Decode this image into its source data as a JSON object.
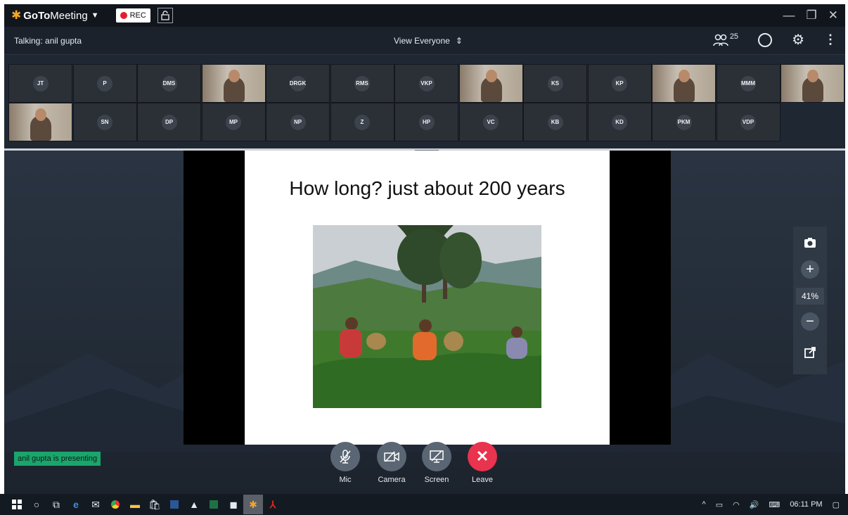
{
  "app": {
    "brand_bold": "GoTo",
    "brand_rest": "Meeting",
    "rec_label": "REC"
  },
  "infobar": {
    "talking": "Talking: anil gupta",
    "view": "View Everyone",
    "attendee_count": "25"
  },
  "participants": [
    {
      "initials": "JT",
      "video": false
    },
    {
      "initials": "P",
      "video": false
    },
    {
      "initials": "DMS",
      "video": false
    },
    {
      "initials": "",
      "video": true
    },
    {
      "initials": "DRGK",
      "video": false
    },
    {
      "initials": "RMS",
      "video": false
    },
    {
      "initials": "VKP",
      "video": false
    },
    {
      "initials": "",
      "video": true
    },
    {
      "initials": "KS",
      "video": false
    },
    {
      "initials": "KP",
      "video": false
    },
    {
      "initials": "",
      "video": true
    },
    {
      "initials": "MMM",
      "video": false
    },
    {
      "initials": "",
      "video": true
    },
    {
      "initials": "",
      "video": true
    },
    {
      "initials": "SN",
      "video": false
    },
    {
      "initials": "DP",
      "video": false
    },
    {
      "initials": "MP",
      "video": false
    },
    {
      "initials": "NP",
      "video": false
    },
    {
      "initials": "Z",
      "video": false
    },
    {
      "initials": "HP",
      "video": false
    },
    {
      "initials": "VC",
      "video": false
    },
    {
      "initials": "KB",
      "video": false
    },
    {
      "initials": "KD",
      "video": false
    },
    {
      "initials": "PKM",
      "video": false
    },
    {
      "initials": "VDP",
      "video": false
    }
  ],
  "slide": {
    "title": "How long? just about 200 years"
  },
  "zoom": {
    "level": "41%"
  },
  "presenting": "anil gupta is presenting",
  "controls": {
    "mic": "Mic",
    "camera": "Camera",
    "screen": "Screen",
    "leave": "Leave"
  },
  "colors": {
    "leave": "#e8344e",
    "presenting": "#1aa56c",
    "brand_orange": "#f5a623",
    "rec_red": "#e0202e"
  },
  "taskbar": {
    "time": "06:11 PM"
  }
}
